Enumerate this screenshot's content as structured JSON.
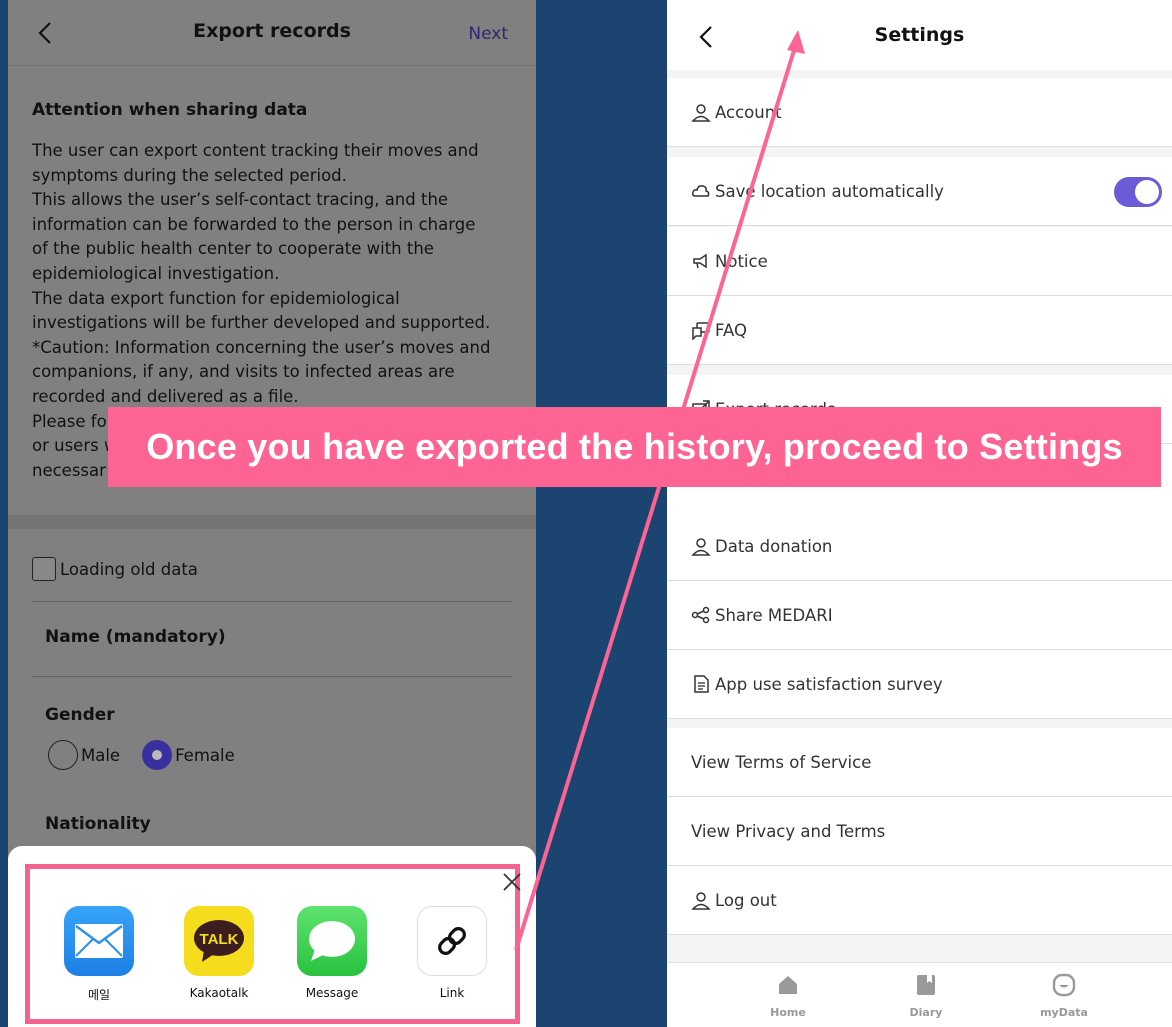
{
  "left_screen": {
    "header": {
      "title": "Export records",
      "next_label": "Next"
    },
    "attention": {
      "title": "Attention when sharing data",
      "lines": [
        "The user can export content tracking their moves and",
        "symptoms during the selected period.",
        "This allows the user’s self-contact tracing, and the",
        "information can be forwarded to the person in charge",
        "of the public health center to cooperate with the",
        "epidemiological investigation.",
        "The data export function for epidemiological",
        "investigations will be further developed and supported.",
        "*Caution: Information concerning the user’s moves and",
        "companions, if any, and visits to infected areas are",
        "recorded and delivered as a file.",
        "Please fo",
        "or users w",
        "necessar"
      ]
    },
    "loading_old_data": {
      "label": "Loading old data",
      "checked": false
    },
    "name_label": "Name (mandatory)",
    "gender": {
      "label": "Gender",
      "options": [
        "Male",
        "Female"
      ],
      "selected": "Female"
    },
    "nationality_label": "Nationality",
    "share_sheet": {
      "items": [
        {
          "label": "메일",
          "icon": "mail-icon"
        },
        {
          "label": "Kakaotalk",
          "icon": "kakaotalk-icon",
          "icon_text": "TALK"
        },
        {
          "label": "Message",
          "icon": "message-icon"
        },
        {
          "label": "Link",
          "icon": "link-icon"
        }
      ]
    }
  },
  "right_screen": {
    "header": {
      "title": "Settings"
    },
    "menu": [
      {
        "label": "Account",
        "icon": "user-icon"
      },
      {
        "label": "Save location automatically",
        "icon": "cloud-icon",
        "toggle_on": true
      },
      {
        "label": "Notice",
        "icon": "megaphone-icon"
      },
      {
        "label": "FAQ",
        "icon": "chat-icon"
      },
      {
        "label": "Export records",
        "icon": "export-icon"
      },
      {
        "label": "Data donation",
        "icon": "user-icon"
      },
      {
        "label": "Share MEDARI",
        "icon": "share-icon"
      },
      {
        "label": "App use satisfaction survey",
        "icon": "document-icon"
      },
      {
        "label": "View Terms of Service"
      },
      {
        "label": "View Privacy and Terms"
      },
      {
        "label": "Log out",
        "icon": "user-icon"
      }
    ],
    "bottom_nav": [
      {
        "label": "Home",
        "icon": "home-icon"
      },
      {
        "label": "Diary",
        "icon": "diary-icon"
      },
      {
        "label": "myData",
        "icon": "mydata-icon"
      }
    ]
  },
  "banner": {
    "text": "Once you have exported the history, proceed to Settings"
  },
  "colors": {
    "background": "#1b4470",
    "highlight": "#f2648e",
    "banner": "#fd6493",
    "accent": "#6b5bd6"
  }
}
